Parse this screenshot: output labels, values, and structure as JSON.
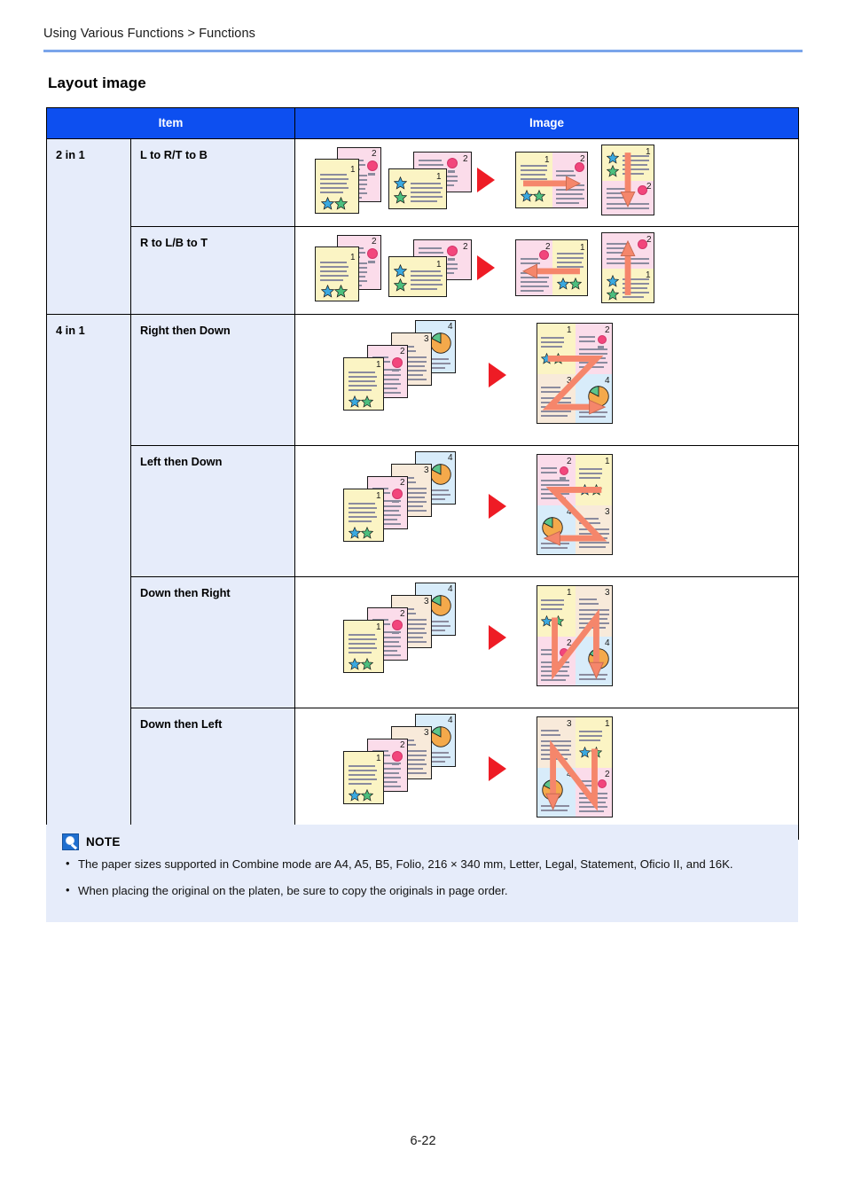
{
  "header": {
    "breadcrumb": "Using Various Functions > Functions",
    "rule_color": "#7aa5ea"
  },
  "section": {
    "title": "Layout image"
  },
  "table": {
    "header_bg": "#0d4ff0",
    "header_text_color": "#ffffff",
    "columns": [
      "Item",
      "Image"
    ],
    "col_item_label": "Item",
    "col_image_label": "Image",
    "groups": [
      {
        "kind": "2 in 1",
        "rows": [
          {
            "item": "L to R/T to B",
            "illustration": "2in1-ltr"
          },
          {
            "item": "R to L/B to T",
            "illustration": "2in1-rtl"
          }
        ]
      },
      {
        "kind": "4 in 1",
        "rows": [
          {
            "item": "Right then Down",
            "illustration": "4in1-right-down"
          },
          {
            "item": "Left then Down",
            "illustration": "4in1-left-down"
          },
          {
            "item": "Down then Right",
            "illustration": "4in1-down-right"
          },
          {
            "item": "Down then Left",
            "illustration": "4in1-down-left"
          }
        ]
      }
    ],
    "page_numbers": [
      "1",
      "2",
      "3",
      "4"
    ],
    "cell_bg": "#e6ecfa",
    "page_colors": {
      "page1": "#fbf4c4",
      "page2": "#fbdcea",
      "page3": "#f8eada",
      "page4": "#d8ecfa",
      "arrow_red": "#ee1c25",
      "arrow_salmon": "#f5866b",
      "text_line": "#8b8b9e",
      "star_blue": "#3aa9e0",
      "star_green": "#4cbf7e",
      "dot_pink": "#f2467c",
      "pie_orange": "#f4a94b",
      "pie_green": "#5cc48a"
    }
  },
  "note": {
    "icon": "note-lightbulb-icon",
    "label": "NOTE",
    "items": [
      "The paper sizes supported in Combine mode are A4, A5, B5, Folio, 216 × 340 mm, Letter, Legal, Statement, Oficio II, and 16K.",
      "When placing the original on the platen, be sure to copy the originals in page order."
    ],
    "bg": "#e6ecfa"
  },
  "footer": {
    "page_number": "6-22"
  }
}
